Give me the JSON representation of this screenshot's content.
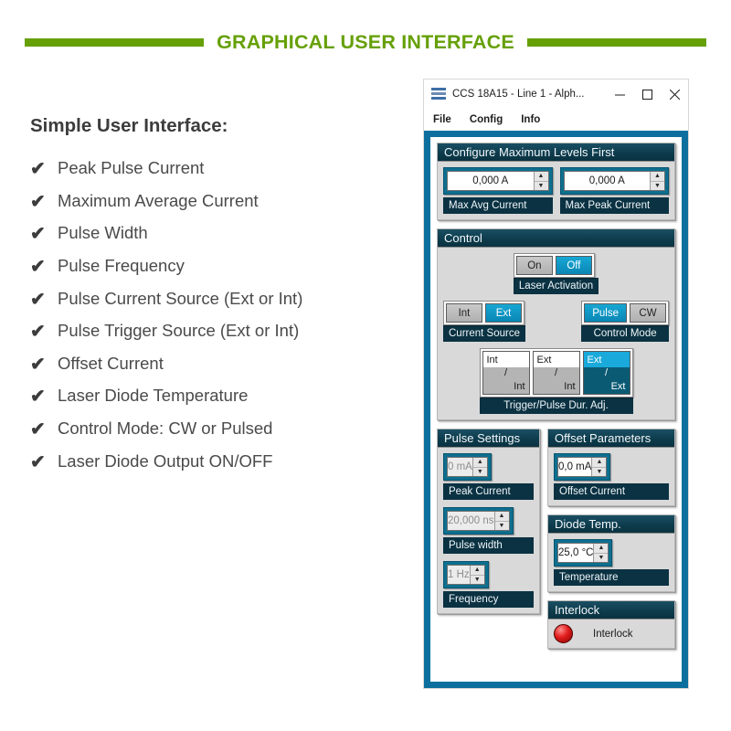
{
  "header": {
    "title": "GRAPHICAL USER INTERFACE",
    "accent_green": "#66a007"
  },
  "left": {
    "title": "Simple User Interface:",
    "tick_glyph": "✔",
    "features": [
      "Peak Pulse Current",
      "Maximum Average Current",
      "Pulse Width",
      "Pulse Frequency",
      "Pulse Current Source (Ext or Int)",
      "Pulse Trigger Source (Ext or Int)",
      "Offset Current",
      "Laser Diode Temperature",
      "Control Mode: CW or Pulsed",
      "Laser Diode Output ON/OFF"
    ]
  },
  "window": {
    "title": "CCS 18A15 - Line 1 - Alph...",
    "frame_color": "#0d6f9e",
    "buttons": {
      "minimize": "—",
      "maximize": "☐",
      "close": "✕"
    },
    "menu": [
      "File",
      "Config",
      "Info"
    ],
    "max_levels": {
      "header": "Configure Maximum Levels First",
      "fields": [
        {
          "value": "0,000 A",
          "label": "Max Avg Current",
          "disabled": false
        },
        {
          "value": "0,000 A",
          "label": "Max Peak Current",
          "disabled": false
        }
      ]
    },
    "control": {
      "header": "Control",
      "laser_activation": {
        "label": "Laser Activation",
        "options": [
          "On",
          "Off"
        ],
        "selected": "Off"
      },
      "current_source": {
        "label": "Current Source",
        "options": [
          "Int",
          "Ext"
        ],
        "selected": "Ext"
      },
      "control_mode": {
        "label": "Control Mode",
        "options": [
          "Pulse",
          "CW"
        ],
        "selected": "Pulse"
      },
      "trigger": {
        "label": "Trigger/Pulse Dur. Adj.",
        "options": [
          {
            "top": "Int",
            "bottom": "Int",
            "selected": false
          },
          {
            "top": "Ext",
            "bottom": "Int",
            "selected": false
          },
          {
            "top": "Ext",
            "bottom": "Ext",
            "selected": true
          }
        ],
        "separator": "/"
      }
    },
    "pulse_settings": {
      "header": "Pulse Settings",
      "fields": [
        {
          "value": "0 mA",
          "label": "Peak Current",
          "disabled": true
        },
        {
          "value": "20,000 ns",
          "label": "Pulse width",
          "disabled": true
        },
        {
          "value": "1 Hz",
          "label": "Frequency",
          "disabled": true
        }
      ]
    },
    "offset_parameters": {
      "header": "Offset Parameters",
      "fields": [
        {
          "value": "0,0 mA",
          "label": "Offset Current",
          "disabled": false
        }
      ]
    },
    "diode_temp": {
      "header": "Diode Temp.",
      "fields": [
        {
          "value": "25,0 °C",
          "label": "Temperature",
          "disabled": false
        }
      ]
    },
    "interlock": {
      "header": "Interlock",
      "label": "Interlock",
      "led_color": "#e01b1b"
    }
  }
}
